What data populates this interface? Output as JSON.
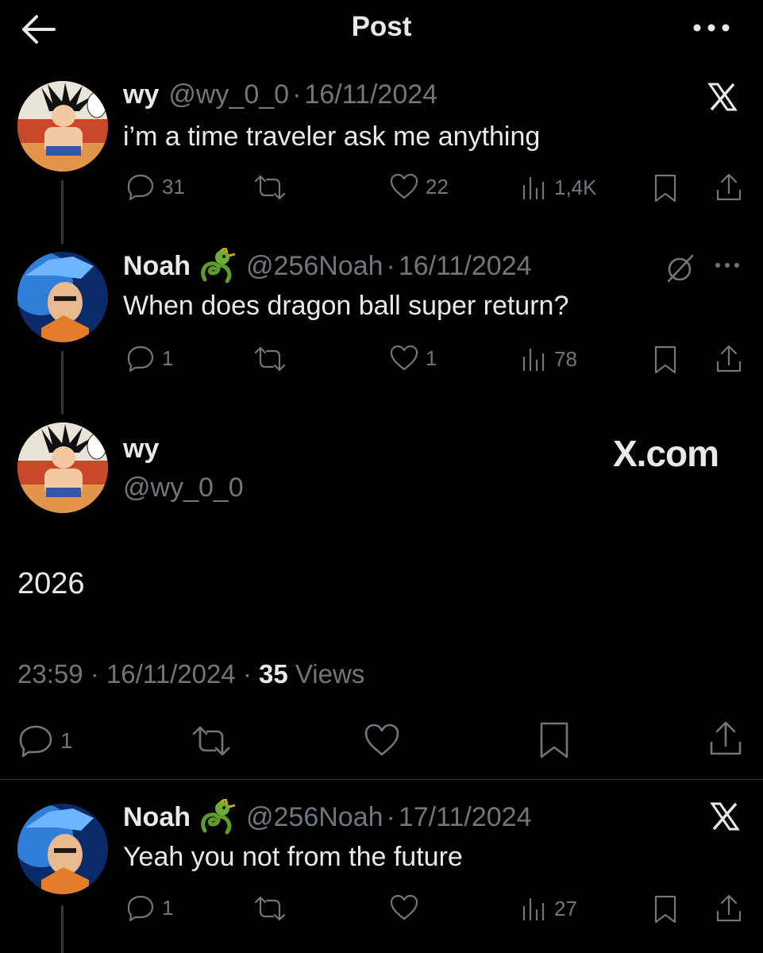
{
  "header": {
    "title": "Post"
  },
  "tweets": [
    {
      "name": "wy",
      "handle": "@wy_0_0",
      "date": "16/11/2024",
      "text": "i’m a time traveler ask me anything",
      "replies": "31",
      "likes": "22",
      "views": "1,4K"
    },
    {
      "name": "Noah",
      "handle": "@256Noah",
      "date": "16/11/2024",
      "text": "When does dragon ball super return?",
      "replies": "1",
      "likes": "1",
      "views": "78"
    }
  ],
  "main": {
    "name": "wy",
    "handle": "@wy_0_0",
    "watermark": "X.com",
    "text": "2026",
    "time": "23:59",
    "date": "16/11/2024",
    "views_count": "35",
    "views_label": "Views",
    "replies": "1"
  },
  "reply": {
    "name": "Noah",
    "handle": "@256Noah",
    "date": "17/11/2024",
    "text": "Yeah you not from the future",
    "replies": "1",
    "views": "27"
  },
  "separator": "·",
  "colors": {
    "background": "#000000",
    "text": "#e7e9ea",
    "muted": "#71767b",
    "divider": "#2f3336"
  }
}
